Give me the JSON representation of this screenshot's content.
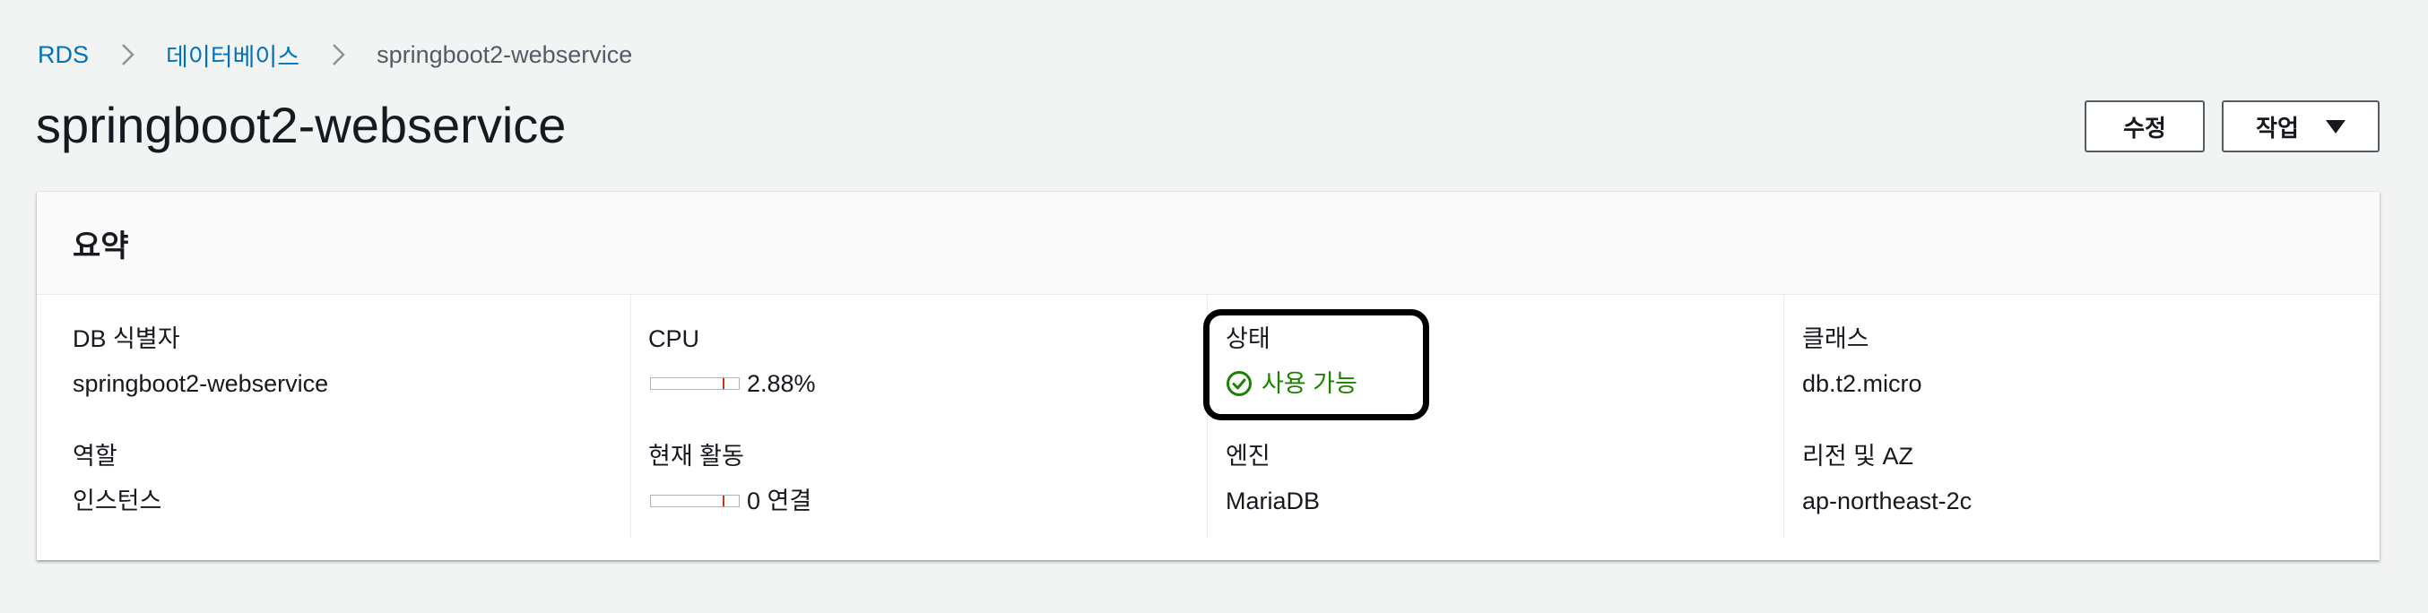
{
  "breadcrumb": {
    "items": [
      "RDS",
      "데이터베이스"
    ],
    "current": "springboot2-webservice"
  },
  "page": {
    "title": "springboot2-webservice"
  },
  "actions": {
    "modify_label": "수정",
    "actions_label": "작업"
  },
  "summary": {
    "title": "요약",
    "db_identifier": {
      "label": "DB 식별자",
      "value": "springboot2-webservice"
    },
    "role": {
      "label": "역할",
      "value": "인스턴스"
    },
    "cpu": {
      "label": "CPU",
      "value": "2.88%"
    },
    "current_activity": {
      "label": "현재 활동",
      "value": "0 연결"
    },
    "status": {
      "label": "상태",
      "value": "사용 가능"
    },
    "engine": {
      "label": "엔진",
      "value": "MariaDB"
    },
    "class": {
      "label": "클래스",
      "value": "db.t2.micro"
    },
    "region_az": {
      "label": "리전 및 AZ",
      "value": "ap-northeast-2c"
    }
  },
  "colors": {
    "link": "#0073bb",
    "status_ok": "#1d8102",
    "background": "#f2f3f3",
    "highlight": "#000000"
  },
  "icons": {
    "breadcrumb_separator": "chevron-right-icon",
    "status": "check-circle-icon",
    "dropdown": "caret-down-icon"
  }
}
